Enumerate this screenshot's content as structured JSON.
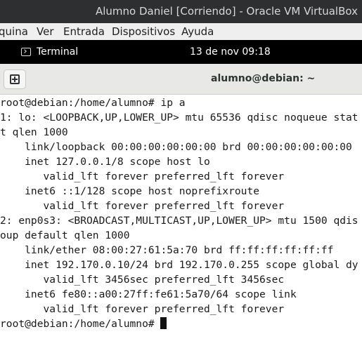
{
  "vbox": {
    "window_title": "Alumno Daniel [Corriendo] - Oracle VM VirtualBox",
    "menu": [
      "quina",
      "Ver",
      "Entrada",
      "Dispositivos",
      "Ayuda"
    ]
  },
  "gnome_topbar": {
    "app_label": "Terminal",
    "app_icon": "terminal-icon",
    "clock": "13 de nov  09:18"
  },
  "terminal": {
    "header_title": "alumno@debian: ~",
    "newtab_icon": "new-tab-plus-icon",
    "lines": [
      "root@debian:/home/alumno# ip a",
      "1: lo: <LOOPBACK,UP,LOWER_UP> mtu 65536 qdisc noqueue stat",
      "t qlen 1000",
      "    link/loopback 00:00:00:00:00:00 brd 00:00:00:00:00:00",
      "    inet 127.0.0.1/8 scope host lo",
      "       valid_lft forever preferred_lft forever",
      "    inet6 ::1/128 scope host noprefixroute",
      "       valid_lft forever preferred_lft forever",
      "2: enp0s3: <BROADCAST,MULTICAST,UP,LOWER_UP> mtu 1500 qdis",
      "oup default qlen 1000",
      "    link/ether 08:00:27:61:5a:70 brd ff:ff:ff:ff:ff:ff",
      "    inet 192.170.0.10/24 brd 192.170.0.255 scope global dy",
      "       valid_lft 3456sec preferred_lft 3456sec",
      "    inet6 fe80::a00:27ff:fe61:5a70/64 scope link",
      "       valid_lft forever preferred_lft forever"
    ],
    "prompt": "root@debian:/home/alumno# "
  }
}
